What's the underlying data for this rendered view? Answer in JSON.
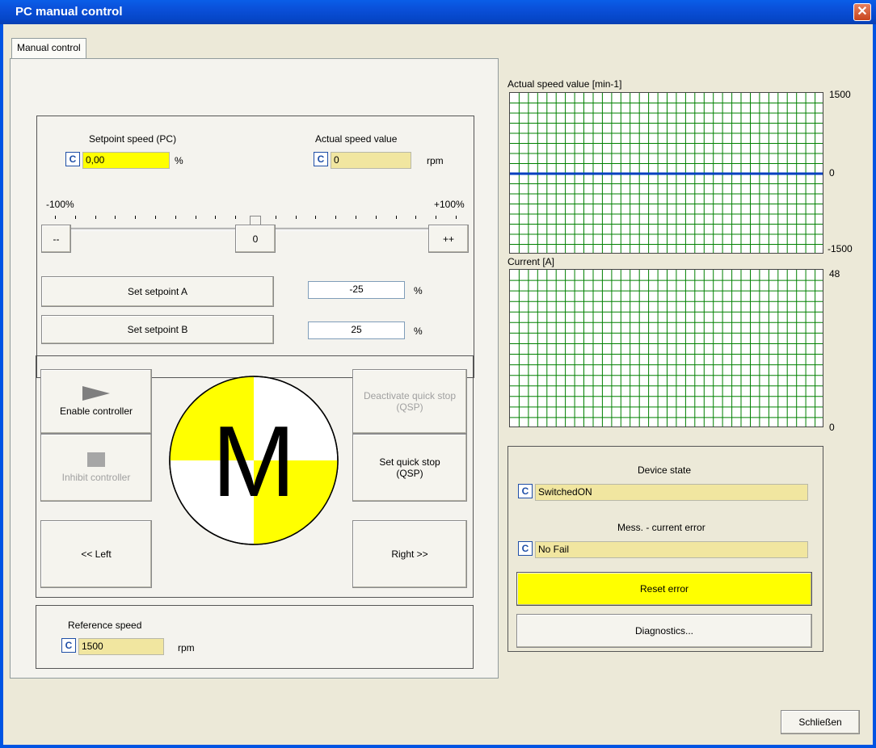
{
  "window": {
    "title": "PC manual control",
    "close_icon": "close-icon"
  },
  "tabs": [
    "Manual control"
  ],
  "setpoint": {
    "label": "Setpoint speed (PC)",
    "c_label": "C",
    "value": "0,00",
    "unit": "%"
  },
  "actual": {
    "label": "Actual speed value",
    "c_label": "C",
    "value": "0",
    "unit": "rpm"
  },
  "slider": {
    "min_label": "-100%",
    "max_label": "+100%",
    "value_percent": 0
  },
  "step_buttons": {
    "minus": "--",
    "zero": "0",
    "plus": "++"
  },
  "setpoint_a": {
    "button": "Set setpoint A",
    "value": "-25",
    "unit": "%"
  },
  "setpoint_b": {
    "button": "Set setpoint B",
    "value": "25",
    "unit": "%"
  },
  "control": {
    "enable": "Enable controller",
    "inhibit": "Inhibit controller",
    "deactivate_qsp": "Deactivate quick stop (QSP)",
    "set_qsp": "Set quick stop (QSP)",
    "left": "<< Left",
    "right": "Right >>",
    "motor_letter": "M"
  },
  "reference": {
    "label": "Reference speed",
    "c_label": "C",
    "value": "1500",
    "unit": "rpm"
  },
  "speed_chart": {
    "title": "Actual speed value [min-1]",
    "max": "1500",
    "mid": "0",
    "min": "-1500",
    "value": 0
  },
  "current_chart": {
    "title": "Current [A]",
    "max": "48",
    "min": "0",
    "value": 0
  },
  "device": {
    "state_label": "Device state",
    "state_c": "C",
    "state_value": "SwitchedON",
    "error_label": "Mess. - current error",
    "error_c": "C",
    "error_value": "No Fail",
    "reset_button": "Reset error",
    "diag_button": "Diagnostics..."
  },
  "footer": {
    "close_button": "Schließen"
  },
  "colors": {
    "accent_yellow": "#ffff00",
    "field_khaki": "#f1e6a0",
    "chart_line": "#003fbf",
    "grid": "#008000"
  }
}
